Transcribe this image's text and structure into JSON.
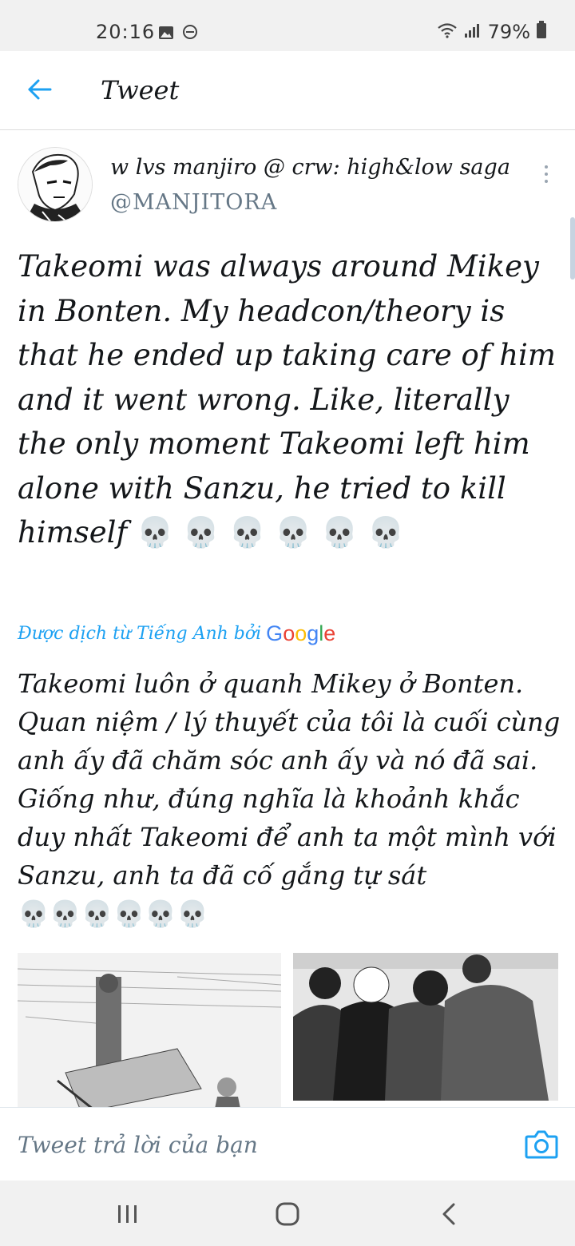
{
  "status_bar": {
    "time": "20:16",
    "battery": "79%"
  },
  "header": {
    "title": "Tweet"
  },
  "tweet": {
    "display_name": "w lvs manjiro @ crw: high&low saga",
    "handle": "@MANJITORA",
    "text": "Takeomi was always around Mikey in Bonten. My headcon/theory is that he ended up taking care of him and it went wrong. Like, literally the only moment Takeomi left him alone with Sanzu, he tried to kill himself",
    "emoji": "💀 💀 💀 💀 💀 💀",
    "translated_label": "Được dịch từ Tiếng Anh bởi",
    "translator_brand": "Google",
    "translation_text": "Takeomi luôn ở quanh Mikey ở Bonten. Quan niệm / lý thuyết của tôi là cuối cùng anh ấy đã chăm sóc anh ấy và nó đã sai. Giống như, đúng nghĩa là khoảnh khắc duy nhất Takeomi để anh ta một mình với Sanzu, anh ta đã cố gắng tự sát",
    "translation_emoji": "💀💀💀💀💀💀"
  },
  "reply": {
    "placeholder": "Tweet trả lời của bạn"
  },
  "icons": {
    "back": "arrow-left-icon",
    "more": "more-vertical-icon",
    "camera": "camera-icon",
    "nav_recents": "recents-icon",
    "nav_home": "home-icon",
    "nav_back": "chevron-left-icon"
  },
  "colors": {
    "accent": "#1da1f2",
    "secondary_text": "#657786"
  }
}
